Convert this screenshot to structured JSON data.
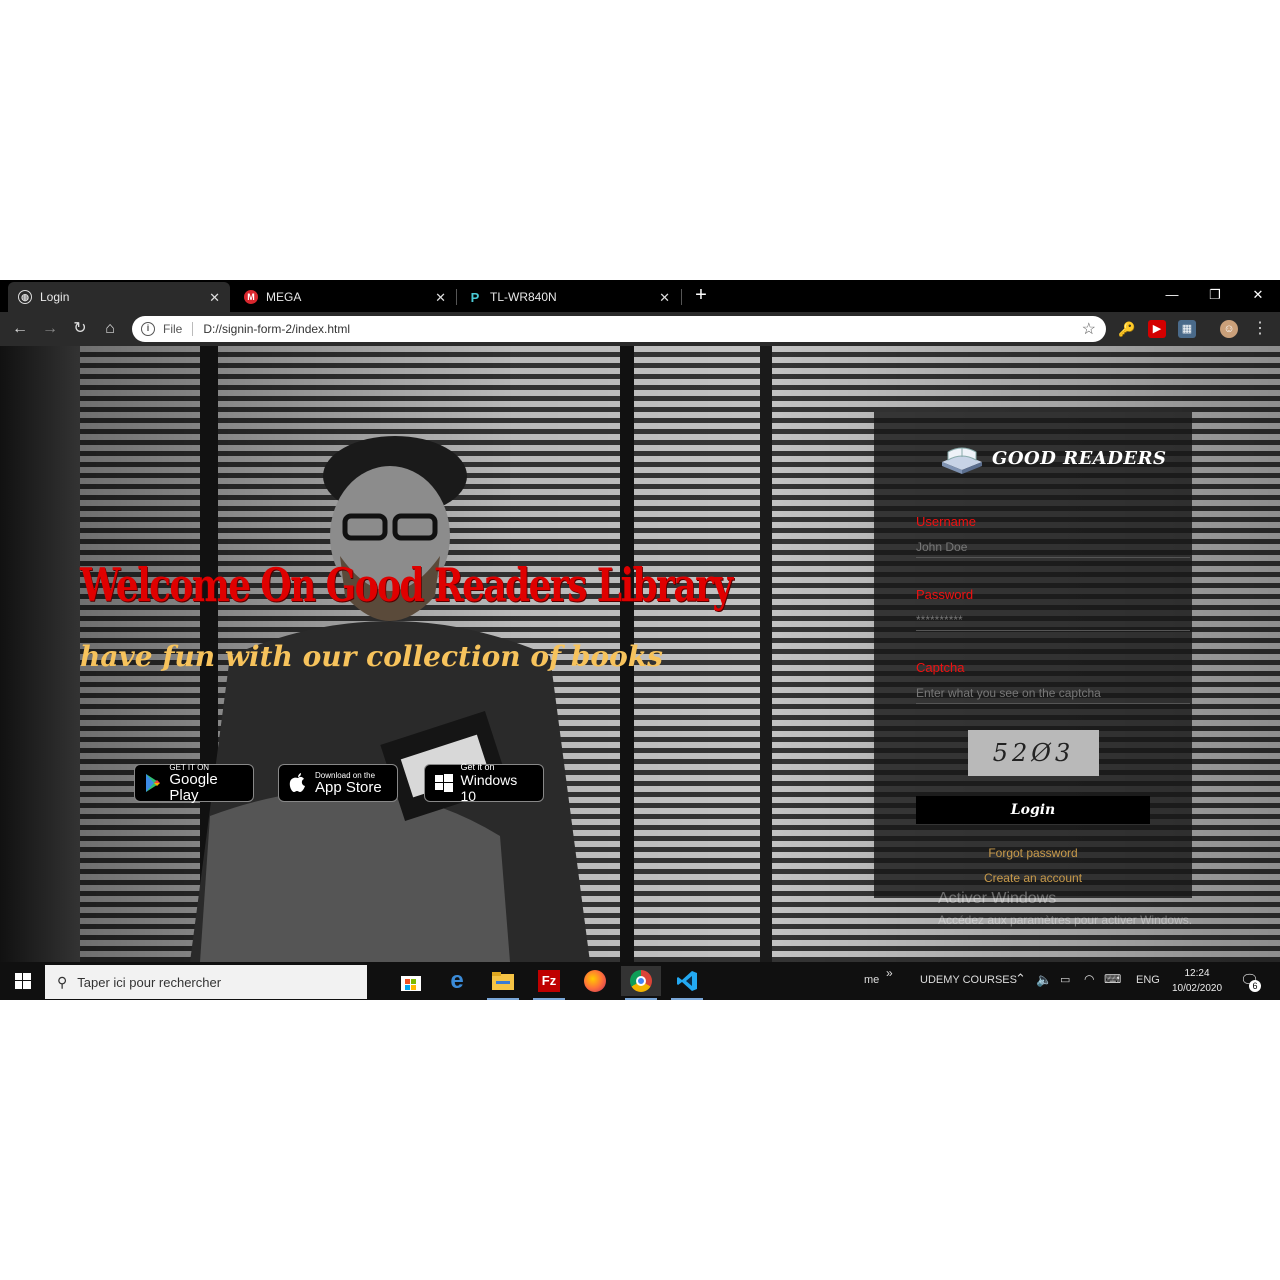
{
  "browser": {
    "tabs": [
      {
        "label": "Login",
        "active": true
      },
      {
        "label": "MEGA",
        "active": false
      },
      {
        "label": "TL-WR840N",
        "active": false
      }
    ],
    "address": {
      "scheme": "File",
      "url": "D://signin-form-2/index.html"
    }
  },
  "page": {
    "hero_title": "Welcome On Good Readers Library",
    "hero_subtitle": "have fun with our collection of books",
    "badges": {
      "google": {
        "small": "GET IT ON",
        "big": "Google Play"
      },
      "apple": {
        "small": "Download on the",
        "big": "App Store"
      },
      "windows": {
        "small": "Get it on",
        "big": "Windows 10"
      }
    },
    "login": {
      "logo_text": "GOOD READERS",
      "username_label": "Username",
      "username_placeholder": "John Doe",
      "password_label": "Password",
      "password_placeholder": "**********",
      "captcha_label": "Captcha",
      "captcha_placeholder": "Enter what you see on the captcha",
      "captcha_code": "52Ø3",
      "login_button": "Login",
      "forgot_link": "Forgot password",
      "create_link": "Create an account"
    },
    "watermark": {
      "line1": "Activer Windows",
      "line2": "Accédez aux paramètres pour activer Windows."
    }
  },
  "taskbar": {
    "search_placeholder": "Taper ici pour rechercher",
    "tray_me": "me",
    "tray_chevron": "»",
    "tray_toolbar": "UDEMY COURSES",
    "language": "ENG",
    "time": "12:24",
    "date": "10/02/2020",
    "notifications": "6"
  },
  "colors": {
    "title_red": "#e00000",
    "subtitle_gold": "#f7c35c",
    "label_red": "#e11111",
    "link_gold": "#c89a4a"
  }
}
